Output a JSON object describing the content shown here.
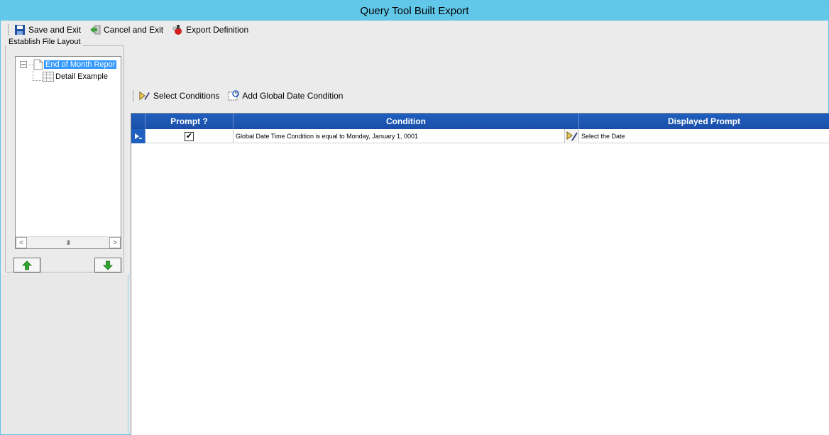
{
  "window": {
    "title": "Query Tool Built Export"
  },
  "toolbar": {
    "save_label": "Save and Exit",
    "cancel_label": "Cancel and Exit",
    "export_label": "Export Definition"
  },
  "layout_panel": {
    "title": "Establish File Layout",
    "tree": [
      {
        "label": "End of Month Repor",
        "selected": true
      },
      {
        "label": "Detail Example",
        "selected": false
      }
    ],
    "scroll_thumb": "III"
  },
  "conditions_toolbar": {
    "select_label": "Select Conditions",
    "add_global_label": "Add Global Date Condition"
  },
  "grid": {
    "columns": [
      "Prompt ?",
      "Condition",
      "Displayed Prompt"
    ],
    "rows": [
      {
        "prompt_checked": true,
        "condition": "Global Date Time Condition is equal to Monday, January 1, 0001",
        "displayed_prompt": "Select the Date"
      }
    ]
  },
  "colors": {
    "title_bar": "#62c8ea",
    "grid_header": "#1f5fbf",
    "selection": "#3399ff"
  }
}
